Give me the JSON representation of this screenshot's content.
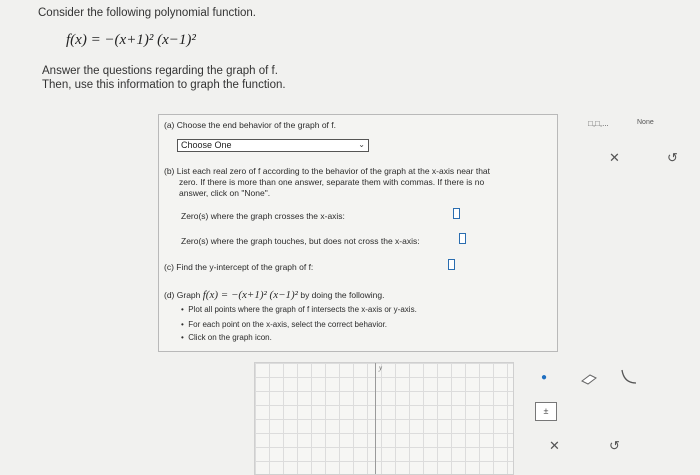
{
  "header": {
    "instruction": "Consider the following polynomial function.",
    "function": "f(x) = −(x+1)² (x−1)²",
    "answer_line1": "Answer the questions regarding the graph of f.",
    "answer_line2": "Then, use this information to graph the function."
  },
  "part_a": {
    "label": "(a) Choose the end behavior of the graph of f.",
    "dropdown_value": "Choose One"
  },
  "part_b": {
    "line1": "(b) List each real zero of f according to the behavior of the graph at the x-axis near that",
    "line2": "zero. If there is more than one answer, separate them with commas. If there is no",
    "line3": "answer, click on \"None\".",
    "crosses_label": "Zero(s) where the graph crosses the x-axis:",
    "touches_label": "Zero(s) where the graph touches, but does not cross the x-axis:"
  },
  "part_c": {
    "label": "(c) Find the y-intercept of the graph of f:"
  },
  "part_d": {
    "label_prefix": "(d) Graph",
    "function": "f(x) = −(x+1)² (x−1)²",
    "label_suffix": "by doing the following.",
    "bullets": [
      "Plot all points where the graph of f intersects the x-axis or y-axis.",
      "For each point on the x-axis, select the correct behavior.",
      "Click on the graph icon."
    ]
  },
  "side_tools": {
    "none_label": "None",
    "multi_box_label": "□,□,...",
    "clear_symbol": "✕",
    "undo_symbol": "↺"
  },
  "graph_tools": {
    "point_symbol": "●",
    "clear_symbol": "✕",
    "undo_symbol": "↺",
    "graph_icon_label": "±"
  },
  "graph": {
    "y_axis_label": "y"
  }
}
